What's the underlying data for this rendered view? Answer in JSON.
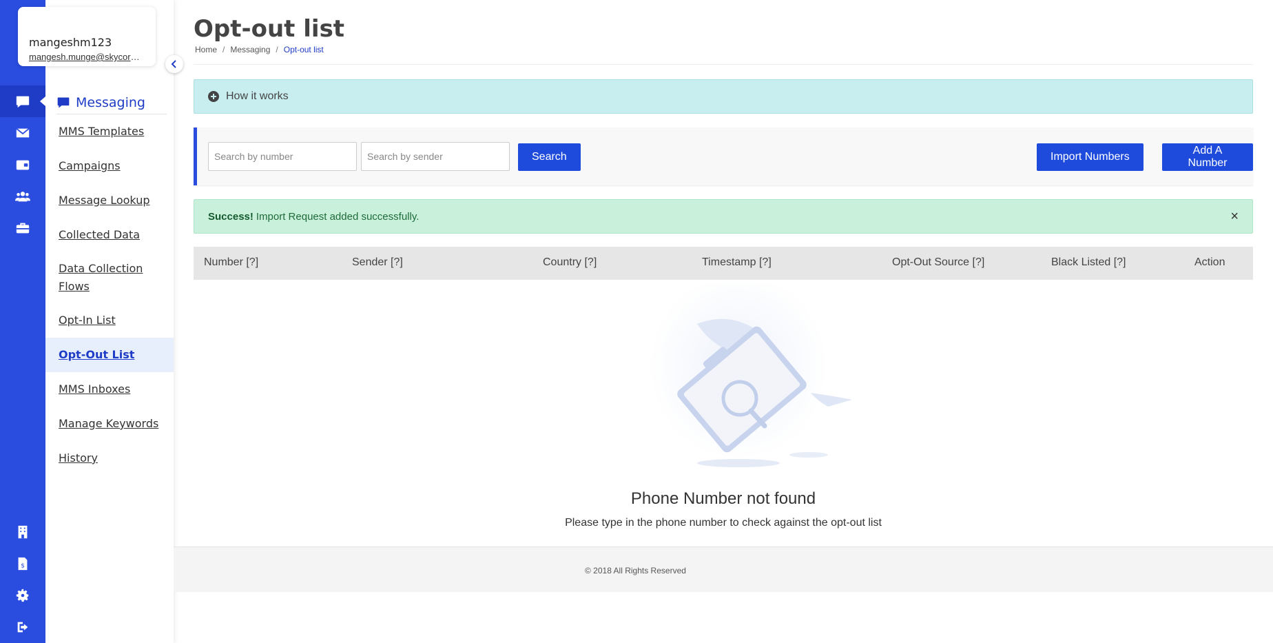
{
  "user": {
    "name": "mangeshm123",
    "email": "mangesh.munge@skycore.com"
  },
  "sidebar": {
    "section_title": "Messaging",
    "items": [
      {
        "label": "MMS Templates"
      },
      {
        "label": "Campaigns"
      },
      {
        "label": "Message Lookup"
      },
      {
        "label": "Collected Data"
      },
      {
        "label": "Data Collection Flows"
      },
      {
        "label": "Opt-In List"
      },
      {
        "label": "Opt-Out List",
        "active": true
      },
      {
        "label": "MMS Inboxes"
      },
      {
        "label": "Manage Keywords"
      },
      {
        "label": "History"
      }
    ]
  },
  "rail": {
    "top_icons": [
      "chat-icon",
      "envelope-icon",
      "wallet-icon",
      "users-icon",
      "toolbox-icon"
    ],
    "bottom_icons": [
      "building-icon",
      "invoice-icon",
      "gear-icon",
      "logout-icon"
    ]
  },
  "page": {
    "title": "Opt-out list",
    "breadcrumb": [
      "Home",
      "Messaging",
      "Opt-out list"
    ]
  },
  "how_it_works": {
    "label": "How it works"
  },
  "toolbar": {
    "search_number_placeholder": "Search by number",
    "search_sender_placeholder": "Search by sender",
    "search_label": "Search",
    "import_label": "Import Numbers",
    "add_label": "Add A Number"
  },
  "alert": {
    "strong": "Success!",
    "message": "Import Request added successfully.",
    "close": "×"
  },
  "table": {
    "headers": [
      "Number [?]",
      "Sender [?]",
      "Country [?]",
      "Timestamp [?]",
      "Opt-Out Source [?]",
      "Black Listed [?]",
      "Action"
    ]
  },
  "empty": {
    "title": "Phone Number not found",
    "subtitle": "Please type in the phone number to check against the opt-out list"
  },
  "footer": {
    "copyright": "© 2018 All Rights Reserved"
  },
  "colors": {
    "brand": "#2a4de0",
    "button": "#1e4bdc",
    "info_bg": "#c9eef0",
    "success_bg": "#c8f0da"
  }
}
